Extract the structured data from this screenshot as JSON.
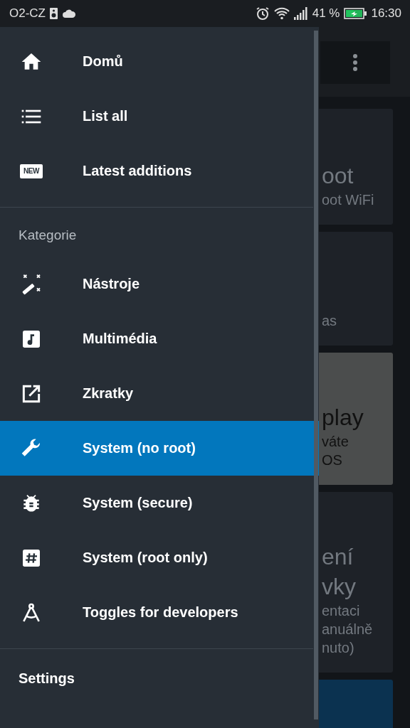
{
  "status_bar": {
    "carrier": "O2-CZ",
    "battery_percent": "41 %",
    "time": "16:30"
  },
  "background": {
    "cards": [
      {
        "kind": "dark",
        "title_lines": [
          "oot"
        ],
        "lines": [
          "oot WiFi"
        ]
      },
      {
        "kind": "dark",
        "lines": [
          "as"
        ]
      },
      {
        "kind": "light",
        "title_lines": [
          "play"
        ],
        "lines": [
          "váte",
          "OS"
        ]
      },
      {
        "kind": "dark",
        "title_lines": [
          "ení",
          "vky"
        ],
        "lines": [
          "entaci",
          "anuálně",
          "nuto)"
        ]
      },
      {
        "kind": "blue"
      }
    ]
  },
  "drawer": {
    "sections": [
      {
        "items": [
          {
            "label": "Domů",
            "selected": false
          },
          {
            "label": "List all",
            "selected": false
          },
          {
            "label": "Latest additions",
            "selected": false,
            "badge": "NEW"
          }
        ]
      },
      {
        "header": "Kategorie",
        "items": [
          {
            "label": "Nástroje",
            "selected": false
          },
          {
            "label": "Multimédia",
            "selected": false
          },
          {
            "label": "Zkratky",
            "selected": false
          },
          {
            "label": "System (no root)",
            "selected": true
          },
          {
            "label": "System (secure)",
            "selected": false
          },
          {
            "label": "System (root only)",
            "selected": false
          },
          {
            "label": "Toggles for developers",
            "selected": false
          }
        ]
      }
    ],
    "footer": "Settings"
  }
}
